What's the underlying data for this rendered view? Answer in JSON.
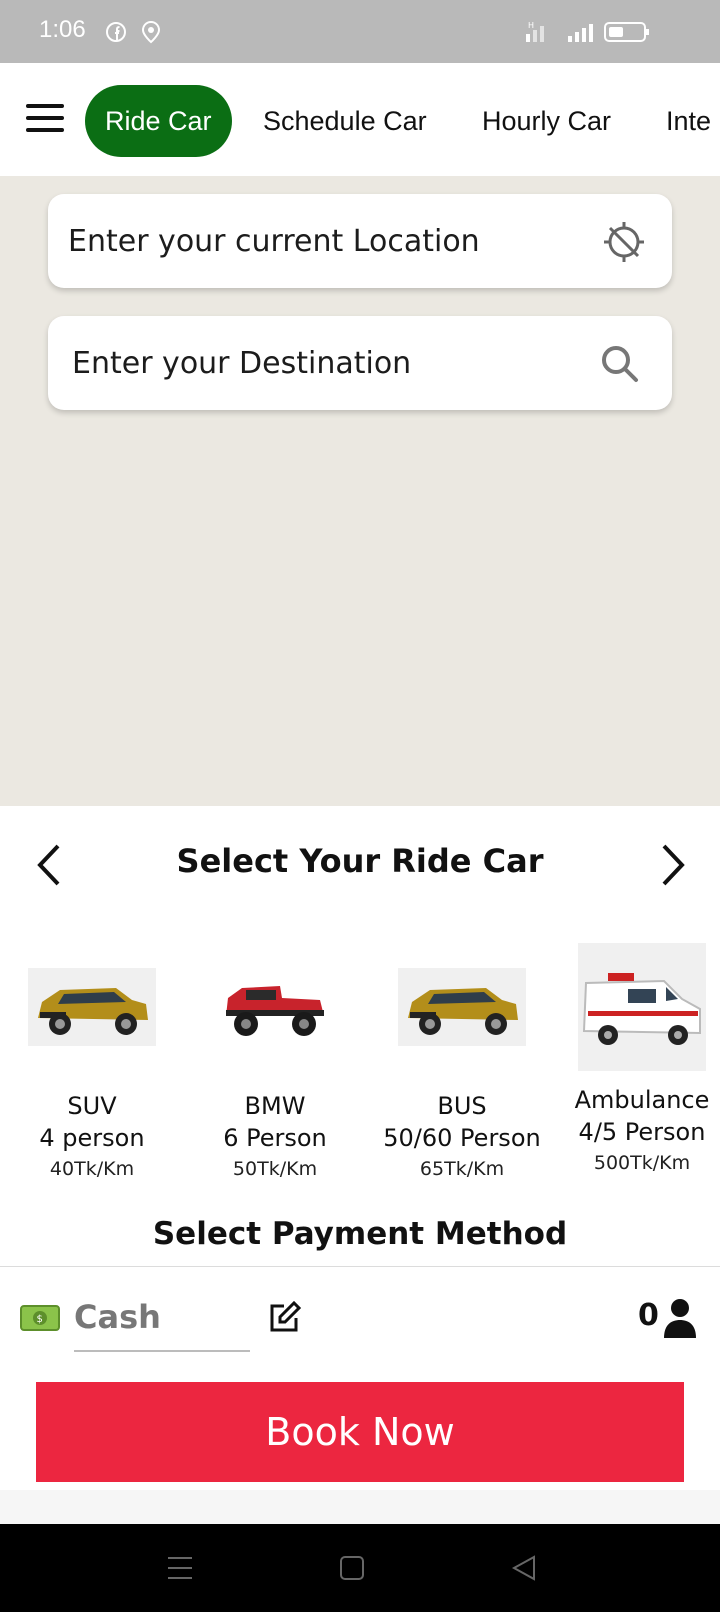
{
  "status_bar": {
    "time": "1:06",
    "icons": [
      "facebook-icon",
      "location-shield-icon",
      "signal-icon",
      "signal-icon",
      "battery-icon"
    ]
  },
  "top_nav": {
    "menu_icon": "menu-icon",
    "tabs": [
      {
        "label": "Ride Car",
        "active": true
      },
      {
        "label": "Schedule Car",
        "active": false
      },
      {
        "label": "Hourly Car",
        "active": false
      },
      {
        "label": "Inte",
        "active": false
      }
    ],
    "active_color": "#0b6e14"
  },
  "map": {
    "current_location_placeholder": "Enter your current Location",
    "current_location_icon": "gps-off-icon",
    "destination_placeholder": "Enter your Destination",
    "destination_icon": "search-icon",
    "background_color": "#ebe8e1"
  },
  "ride_select": {
    "title": "Select Your Ride Car",
    "prev_icon": "chevron-left-icon",
    "next_icon": "chevron-right-icon",
    "cars": [
      {
        "name": "SUV",
        "capacity": "4 person",
        "price": "40Tk/Km",
        "icon": "suv-car-icon"
      },
      {
        "name": "BMW",
        "capacity": "6 Person",
        "price": "50Tk/Km",
        "icon": "jeep-car-icon"
      },
      {
        "name": "BUS",
        "capacity": "50/60 Person",
        "price": "65Tk/Km",
        "icon": "suv-car-icon"
      },
      {
        "name": "Ambulance",
        "capacity": "4/5 Person",
        "price": "500Tk/Km",
        "icon": "ambulance-icon"
      }
    ]
  },
  "payment": {
    "title": "Select Payment Method",
    "method": "Cash",
    "cash_icon": "cash-icon",
    "edit_icon": "edit-icon",
    "passenger_count": "0",
    "person_icon": "person-icon"
  },
  "book_button": {
    "label": "Book Now",
    "color": "#ec2640"
  },
  "nav_bar": {
    "icons": [
      "menu-lines-icon",
      "home-square-icon",
      "back-triangle-icon"
    ]
  }
}
